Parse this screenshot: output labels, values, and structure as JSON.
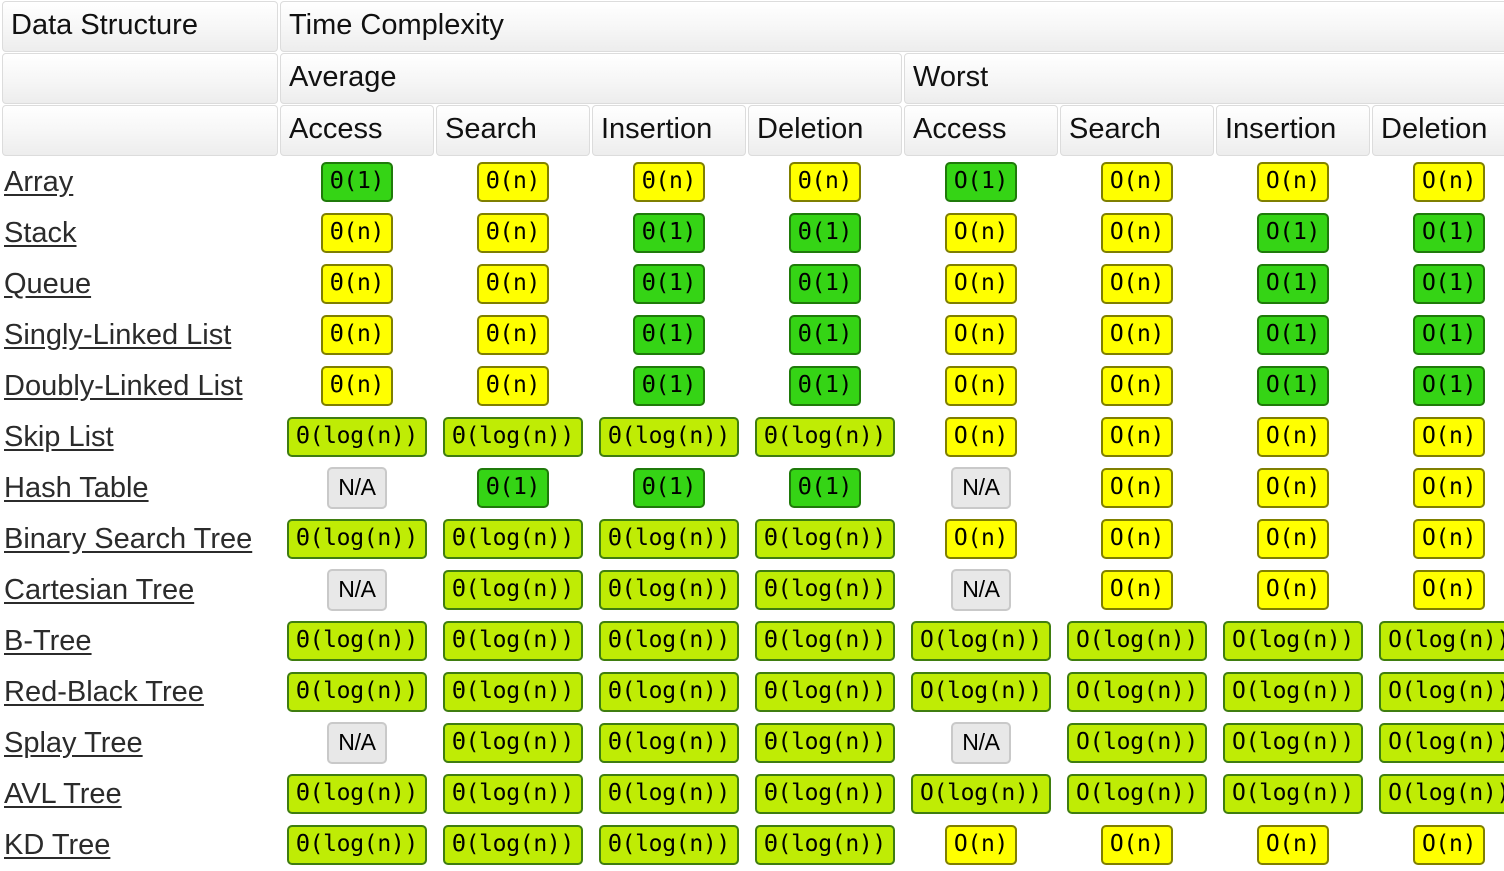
{
  "table": {
    "corner_label": "Data Structure",
    "group_label": "Time Complexity",
    "case_groups": [
      {
        "label": "Average",
        "span": 4
      },
      {
        "label": "Worst",
        "span": 4
      }
    ],
    "operations": [
      "Access",
      "Search",
      "Insertion",
      "Deletion",
      "Access",
      "Search",
      "Insertion",
      "Deletion"
    ],
    "legend": {
      "constant_color": "#35d415",
      "log_color": "#bfec05",
      "linear_color": "#ffff00",
      "na_color": "#e8e8e8",
      "link_color": "#2b2b2b"
    },
    "rows": [
      {
        "name": "Array",
        "cells": [
          {
            "text": "Θ(1)",
            "cls": "c-constant"
          },
          {
            "text": "Θ(n)",
            "cls": "c-linear"
          },
          {
            "text": "Θ(n)",
            "cls": "c-linear"
          },
          {
            "text": "Θ(n)",
            "cls": "c-linear"
          },
          {
            "text": "O(1)",
            "cls": "c-constant"
          },
          {
            "text": "O(n)",
            "cls": "c-linear"
          },
          {
            "text": "O(n)",
            "cls": "c-linear"
          },
          {
            "text": "O(n)",
            "cls": "c-linear"
          }
        ]
      },
      {
        "name": "Stack",
        "cells": [
          {
            "text": "Θ(n)",
            "cls": "c-linear"
          },
          {
            "text": "Θ(n)",
            "cls": "c-linear"
          },
          {
            "text": "Θ(1)",
            "cls": "c-constant"
          },
          {
            "text": "Θ(1)",
            "cls": "c-constant"
          },
          {
            "text": "O(n)",
            "cls": "c-linear"
          },
          {
            "text": "O(n)",
            "cls": "c-linear"
          },
          {
            "text": "O(1)",
            "cls": "c-constant"
          },
          {
            "text": "O(1)",
            "cls": "c-constant"
          }
        ]
      },
      {
        "name": "Queue",
        "cells": [
          {
            "text": "Θ(n)",
            "cls": "c-linear"
          },
          {
            "text": "Θ(n)",
            "cls": "c-linear"
          },
          {
            "text": "Θ(1)",
            "cls": "c-constant"
          },
          {
            "text": "Θ(1)",
            "cls": "c-constant"
          },
          {
            "text": "O(n)",
            "cls": "c-linear"
          },
          {
            "text": "O(n)",
            "cls": "c-linear"
          },
          {
            "text": "O(1)",
            "cls": "c-constant"
          },
          {
            "text": "O(1)",
            "cls": "c-constant"
          }
        ]
      },
      {
        "name": "Singly-Linked List",
        "cells": [
          {
            "text": "Θ(n)",
            "cls": "c-linear"
          },
          {
            "text": "Θ(n)",
            "cls": "c-linear"
          },
          {
            "text": "Θ(1)",
            "cls": "c-constant"
          },
          {
            "text": "Θ(1)",
            "cls": "c-constant"
          },
          {
            "text": "O(n)",
            "cls": "c-linear"
          },
          {
            "text": "O(n)",
            "cls": "c-linear"
          },
          {
            "text": "O(1)",
            "cls": "c-constant"
          },
          {
            "text": "O(1)",
            "cls": "c-constant"
          }
        ]
      },
      {
        "name": "Doubly-Linked List",
        "cells": [
          {
            "text": "Θ(n)",
            "cls": "c-linear"
          },
          {
            "text": "Θ(n)",
            "cls": "c-linear"
          },
          {
            "text": "Θ(1)",
            "cls": "c-constant"
          },
          {
            "text": "Θ(1)",
            "cls": "c-constant"
          },
          {
            "text": "O(n)",
            "cls": "c-linear"
          },
          {
            "text": "O(n)",
            "cls": "c-linear"
          },
          {
            "text": "O(1)",
            "cls": "c-constant"
          },
          {
            "text": "O(1)",
            "cls": "c-constant"
          }
        ]
      },
      {
        "name": "Skip List",
        "cells": [
          {
            "text": "Θ(log(n))",
            "cls": "c-log"
          },
          {
            "text": "Θ(log(n))",
            "cls": "c-log"
          },
          {
            "text": "Θ(log(n))",
            "cls": "c-log"
          },
          {
            "text": "Θ(log(n))",
            "cls": "c-log"
          },
          {
            "text": "O(n)",
            "cls": "c-linear"
          },
          {
            "text": "O(n)",
            "cls": "c-linear"
          },
          {
            "text": "O(n)",
            "cls": "c-linear"
          },
          {
            "text": "O(n)",
            "cls": "c-linear"
          }
        ]
      },
      {
        "name": "Hash Table",
        "cells": [
          {
            "text": "N/A",
            "cls": "c-na"
          },
          {
            "text": "Θ(1)",
            "cls": "c-constant"
          },
          {
            "text": "Θ(1)",
            "cls": "c-constant"
          },
          {
            "text": "Θ(1)",
            "cls": "c-constant"
          },
          {
            "text": "N/A",
            "cls": "c-na"
          },
          {
            "text": "O(n)",
            "cls": "c-linear"
          },
          {
            "text": "O(n)",
            "cls": "c-linear"
          },
          {
            "text": "O(n)",
            "cls": "c-linear"
          }
        ]
      },
      {
        "name": "Binary Search Tree",
        "cells": [
          {
            "text": "Θ(log(n))",
            "cls": "c-log"
          },
          {
            "text": "Θ(log(n))",
            "cls": "c-log"
          },
          {
            "text": "Θ(log(n))",
            "cls": "c-log"
          },
          {
            "text": "Θ(log(n))",
            "cls": "c-log"
          },
          {
            "text": "O(n)",
            "cls": "c-linear"
          },
          {
            "text": "O(n)",
            "cls": "c-linear"
          },
          {
            "text": "O(n)",
            "cls": "c-linear"
          },
          {
            "text": "O(n)",
            "cls": "c-linear"
          }
        ]
      },
      {
        "name": "Cartesian Tree",
        "cells": [
          {
            "text": "N/A",
            "cls": "c-na"
          },
          {
            "text": "Θ(log(n))",
            "cls": "c-log"
          },
          {
            "text": "Θ(log(n))",
            "cls": "c-log"
          },
          {
            "text": "Θ(log(n))",
            "cls": "c-log"
          },
          {
            "text": "N/A",
            "cls": "c-na"
          },
          {
            "text": "O(n)",
            "cls": "c-linear"
          },
          {
            "text": "O(n)",
            "cls": "c-linear"
          },
          {
            "text": "O(n)",
            "cls": "c-linear"
          }
        ]
      },
      {
        "name": "B-Tree",
        "cells": [
          {
            "text": "Θ(log(n))",
            "cls": "c-log"
          },
          {
            "text": "Θ(log(n))",
            "cls": "c-log"
          },
          {
            "text": "Θ(log(n))",
            "cls": "c-log"
          },
          {
            "text": "Θ(log(n))",
            "cls": "c-log"
          },
          {
            "text": "O(log(n))",
            "cls": "c-log"
          },
          {
            "text": "O(log(n))",
            "cls": "c-log"
          },
          {
            "text": "O(log(n))",
            "cls": "c-log"
          },
          {
            "text": "O(log(n))",
            "cls": "c-log"
          }
        ]
      },
      {
        "name": "Red-Black Tree",
        "cells": [
          {
            "text": "Θ(log(n))",
            "cls": "c-log"
          },
          {
            "text": "Θ(log(n))",
            "cls": "c-log"
          },
          {
            "text": "Θ(log(n))",
            "cls": "c-log"
          },
          {
            "text": "Θ(log(n))",
            "cls": "c-log"
          },
          {
            "text": "O(log(n))",
            "cls": "c-log"
          },
          {
            "text": "O(log(n))",
            "cls": "c-log"
          },
          {
            "text": "O(log(n))",
            "cls": "c-log"
          },
          {
            "text": "O(log(n))",
            "cls": "c-log"
          }
        ]
      },
      {
        "name": "Splay Tree",
        "cells": [
          {
            "text": "N/A",
            "cls": "c-na"
          },
          {
            "text": "Θ(log(n))",
            "cls": "c-log"
          },
          {
            "text": "Θ(log(n))",
            "cls": "c-log"
          },
          {
            "text": "Θ(log(n))",
            "cls": "c-log"
          },
          {
            "text": "N/A",
            "cls": "c-na"
          },
          {
            "text": "O(log(n))",
            "cls": "c-log"
          },
          {
            "text": "O(log(n))",
            "cls": "c-log"
          },
          {
            "text": "O(log(n))",
            "cls": "c-log"
          }
        ]
      },
      {
        "name": "AVL Tree",
        "cells": [
          {
            "text": "Θ(log(n))",
            "cls": "c-log"
          },
          {
            "text": "Θ(log(n))",
            "cls": "c-log"
          },
          {
            "text": "Θ(log(n))",
            "cls": "c-log"
          },
          {
            "text": "Θ(log(n))",
            "cls": "c-log"
          },
          {
            "text": "O(log(n))",
            "cls": "c-log"
          },
          {
            "text": "O(log(n))",
            "cls": "c-log"
          },
          {
            "text": "O(log(n))",
            "cls": "c-log"
          },
          {
            "text": "O(log(n))",
            "cls": "c-log"
          }
        ]
      },
      {
        "name": "KD Tree",
        "cells": [
          {
            "text": "Θ(log(n))",
            "cls": "c-log"
          },
          {
            "text": "Θ(log(n))",
            "cls": "c-log"
          },
          {
            "text": "Θ(log(n))",
            "cls": "c-log"
          },
          {
            "text": "Θ(log(n))",
            "cls": "c-log"
          },
          {
            "text": "O(n)",
            "cls": "c-linear"
          },
          {
            "text": "O(n)",
            "cls": "c-linear"
          },
          {
            "text": "O(n)",
            "cls": "c-linear"
          },
          {
            "text": "O(n)",
            "cls": "c-linear"
          }
        ]
      }
    ]
  }
}
